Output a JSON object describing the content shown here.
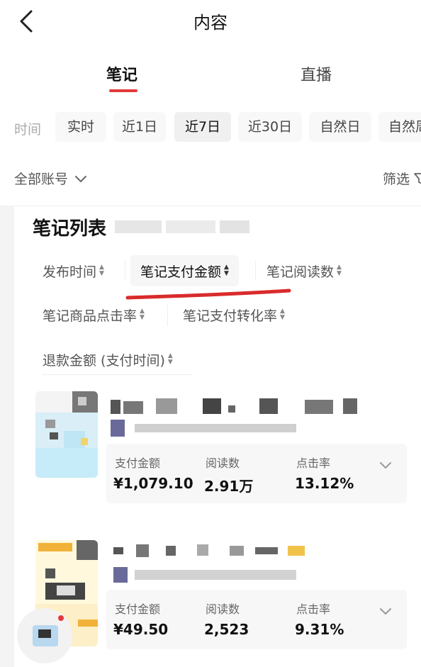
{
  "header": {
    "title": "内容"
  },
  "main_tabs": [
    {
      "label": "笔记",
      "active": true
    },
    {
      "label": "直播",
      "active": false
    }
  ],
  "time_filter": {
    "label": "时间",
    "options": [
      {
        "label": "实时",
        "active": false
      },
      {
        "label": "近1日",
        "active": false
      },
      {
        "label": "近7日",
        "active": true
      },
      {
        "label": "近30日",
        "active": false
      },
      {
        "label": "自然日",
        "active": false
      },
      {
        "label": "自然周",
        "active": false
      }
    ]
  },
  "account": {
    "label": "全部账号"
  },
  "filter": {
    "label": "筛选"
  },
  "list": {
    "title": "笔记列表"
  },
  "sort_options": [
    {
      "label": "发布时间",
      "active": false
    },
    {
      "label": "笔记支付金额",
      "active": true
    },
    {
      "label": "笔记阅读数",
      "active": false
    },
    {
      "label": "笔记商品点击率",
      "active": false
    },
    {
      "label": "笔记支付转化率",
      "active": false
    },
    {
      "label": "退款金额 (支付时间)",
      "active": false
    }
  ],
  "notes": [
    {
      "metrics": [
        {
          "label": "支付金额",
          "value": "¥1,079.10"
        },
        {
          "label": "阅读数",
          "value": "2.91万"
        },
        {
          "label": "点击率",
          "value": "13.12%"
        }
      ]
    },
    {
      "metrics": [
        {
          "label": "支付金额",
          "value": "¥49.50"
        },
        {
          "label": "阅读数",
          "value": "2,523"
        },
        {
          "label": "点击率",
          "value": "9.31%"
        }
      ]
    }
  ],
  "colors": {
    "accent": "#e23a3a",
    "underline_annotation": "#d92b2b"
  },
  "icons": [
    "back-arrow-icon",
    "chevron-down-icon",
    "filter-funnel-icon",
    "sort-arrows-icon",
    "expand-chevron-icon"
  ]
}
